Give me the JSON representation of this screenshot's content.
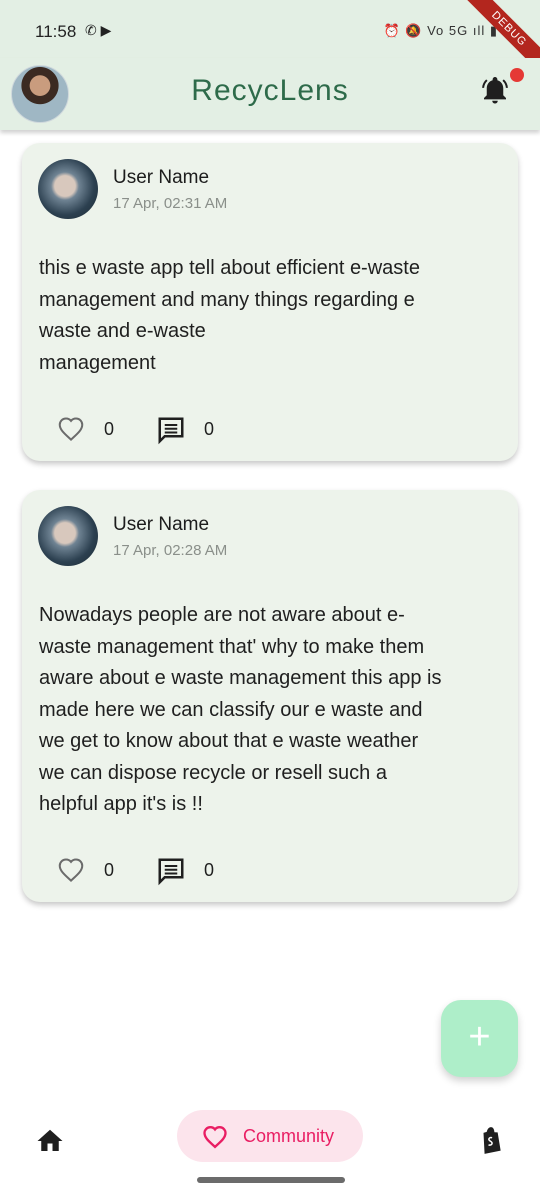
{
  "status_bar": {
    "time": "11:58",
    "left_icons": "✆ ▶",
    "right_icons": "⏰ 🔕 Vo 5G ıll ▮",
    "debug_label": "DEBUG"
  },
  "app_bar": {
    "title": "RecycLens",
    "avatar_icon": "user-avatar",
    "notification_icon": "bell-icon"
  },
  "posts": [
    {
      "user_name": "User Name",
      "date": "17 Apr, 02:31 AM",
      "body": "this e waste app tell about efficient e-waste\nmanagement and many things regarding e\nwaste and e-waste\nmanagement",
      "likes": "0",
      "comments": "0"
    },
    {
      "user_name": "User Name",
      "date": "17 Apr, 02:28 AM",
      "body": "Nowadays people are not aware about e-\nwaste management that' why to make them\naware about e waste management this app is\nmade here we can classify our e waste and\nwe get to know about that e waste weather\nwe can dispose recycle or resell such a\nhelpful app it's is !!",
      "likes": "0",
      "comments": "0"
    }
  ],
  "fab": {
    "label": "+"
  },
  "bottom_nav": {
    "home_icon": "home-icon",
    "community_label": "Community",
    "shop_icon": "shopping-bag-icon"
  },
  "colors": {
    "title": "#2e6b4a",
    "app_bar_bg": "#e3efe4",
    "card_bg": "#edf3eb",
    "fab_bg": "#aeeec9",
    "nav_pill_bg": "#fce4ec",
    "accent_pink": "#e91e63",
    "notification_dot": "#e53935"
  }
}
